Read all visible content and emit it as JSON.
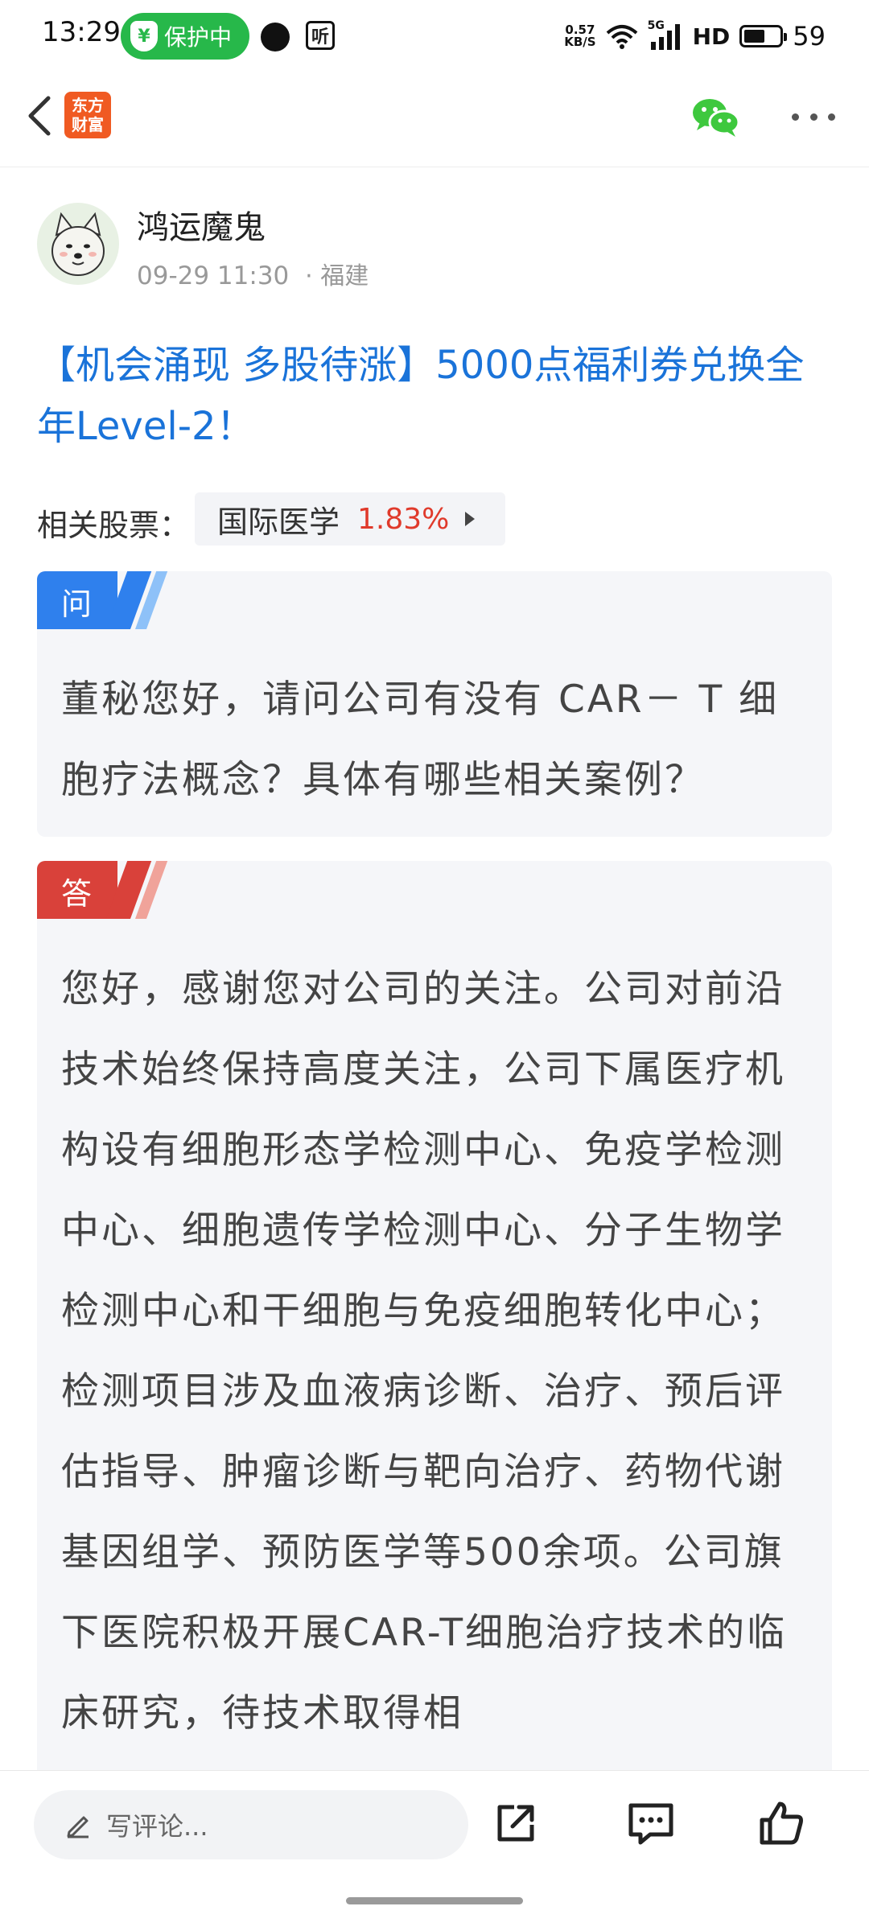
{
  "status_bar": {
    "time": "13:29",
    "protect_label": "保护中",
    "protect_icon": "¥",
    "ting_label": "听",
    "net_speed_value": "0.57",
    "net_speed_unit": "KB/S",
    "network": "5G",
    "hd": "HD",
    "battery_level": "59",
    "battery_fraction": 0.59
  },
  "header": {
    "logo_line1": "东方",
    "logo_line2": "财富",
    "wechat_color": "#3ec83e"
  },
  "author": {
    "name": "鸿运魔鬼",
    "time": "09-29 11:30",
    "location": "· 福建"
  },
  "post": {
    "title": "【机会涌现 多股待涨】5000点福利券兑换全年Level-2！"
  },
  "related": {
    "label": "相关股票：",
    "stock_name": "国际医学",
    "stock_change": "1.83%",
    "change_color": "#e03a2b"
  },
  "qa": {
    "question_tag": "问",
    "question": "董秘您好，请问公司有没有 CAR－ T 细胞疗法概念？具体有哪些相关案例？",
    "answer_tag": "答",
    "answer": "您好，感谢您对公司的关注。公司对前沿技术始终保持高度关注，公司下属医疗机构设有细胞形态学检测中心、免疫学检测中心、细胞遗传学检测中心、分子生物学检测中心和干细胞与免疫细胞转化中心；检测项目涉及血液病诊断、治疗、预后评估指导、肿瘤诊断与靶向治疗、药物代谢基因组学、预防医学等500余项。公司旗下医院积极开展CAR-T细胞治疗技术的临床研究，待技术取得相"
  },
  "bottom_bar": {
    "comment_placeholder": "写评论..."
  },
  "icons": {
    "back": "chevron-left-icon",
    "wechat": "wechat-icon",
    "more": "more-dots-icon",
    "pencil": "pencil-icon",
    "share": "share-icon",
    "message": "message-icon",
    "like": "thumbs-up-icon"
  }
}
